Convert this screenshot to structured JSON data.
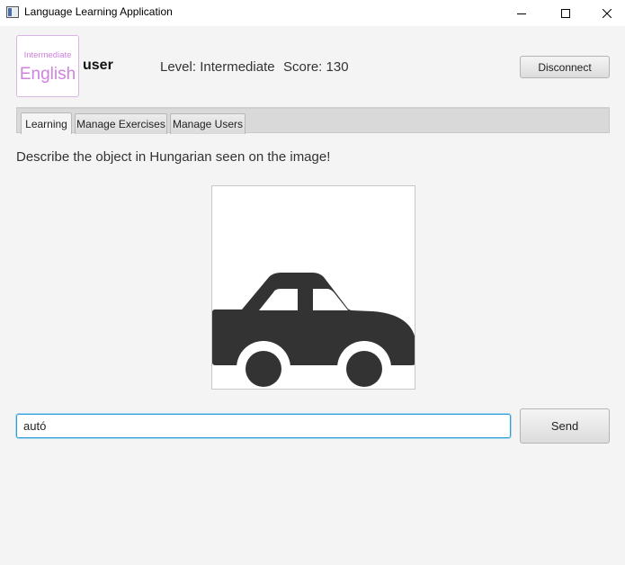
{
  "window": {
    "title": "Language Learning Application",
    "controls": [
      "minimize-icon",
      "maximize-icon",
      "close-icon"
    ]
  },
  "header": {
    "logo_level": "Intermediate",
    "logo_language": "English",
    "username": "user",
    "level_label": "Level: Intermediate",
    "score_label": "Score: 130",
    "disconnect_label": "Disconnect",
    "logo_color": "#cf82e0"
  },
  "tabs": [
    {
      "label": "Learning",
      "active": true
    },
    {
      "label": "Manage Exercises",
      "active": false
    },
    {
      "label": "Manage Users",
      "active": false
    }
  ],
  "exercise": {
    "prompt": "Describe the object in Hungarian seen on the image!",
    "image_icon": "car-icon",
    "answer_value": "autó",
    "send_label": "Send"
  },
  "colors": {
    "focus": "#2d9fd8",
    "icon": "#333333"
  }
}
